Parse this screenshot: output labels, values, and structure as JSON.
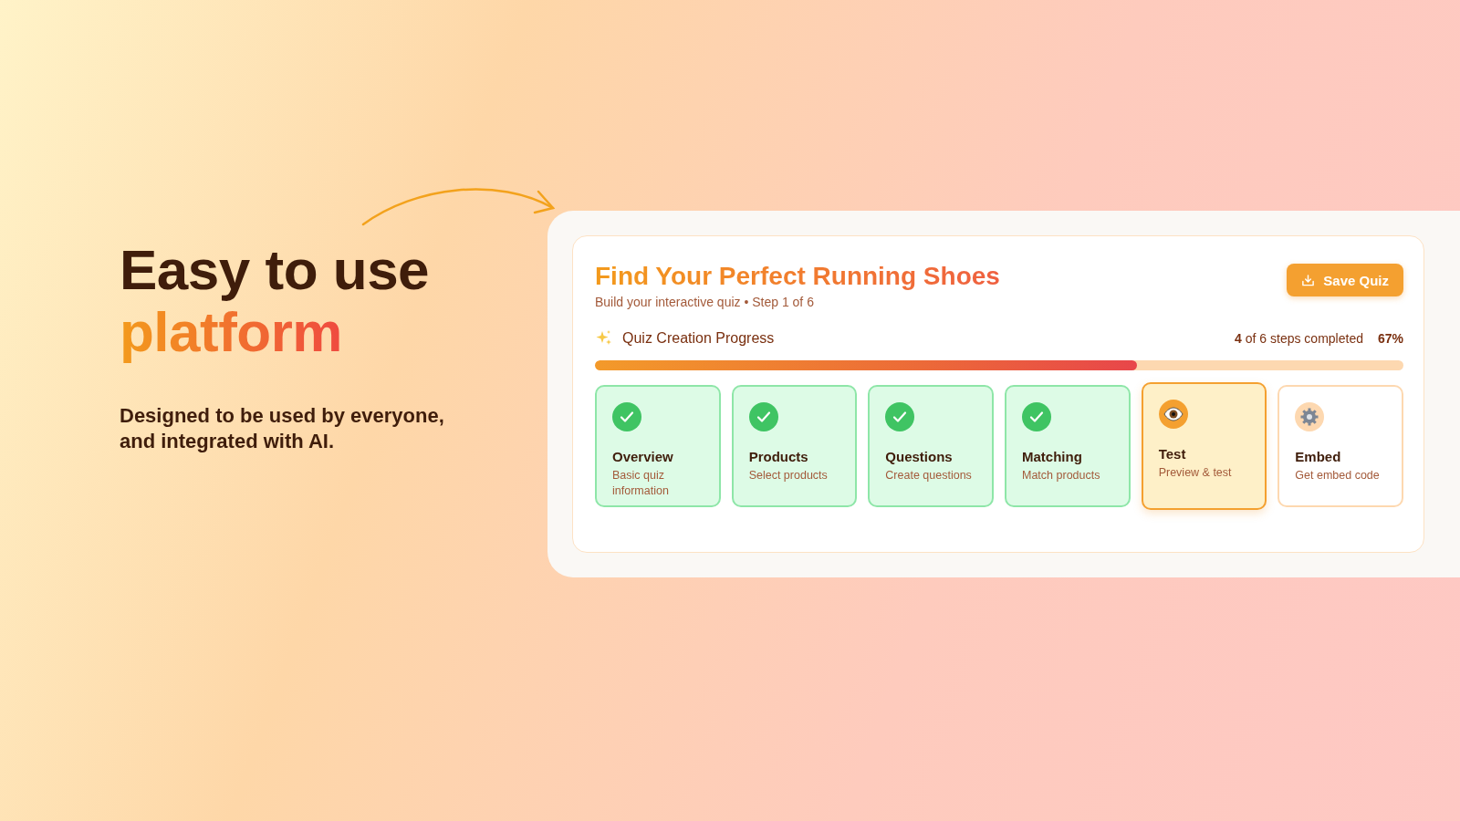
{
  "hero": {
    "title": "Easy to use",
    "title_accent": "platform",
    "subtitle": "Designed to be used by everyone, and integrated with AI."
  },
  "quiz": {
    "title": "Find Your Perfect Running Shoes",
    "subtitle": "Build your interactive quiz • Step 1 of 6",
    "save_button": "Save Quiz",
    "progress": {
      "label": "Quiz Creation Progress",
      "summary": "**4** of 6 steps completed",
      "percent": "67%",
      "level": 0.67
    },
    "steps": [
      {
        "kind": "done",
        "title": "Overview",
        "description": "Basic quiz information"
      },
      {
        "kind": "done",
        "title": "Products",
        "description": "Select products"
      },
      {
        "kind": "done",
        "title": "Questions",
        "description": "Create questions"
      },
      {
        "kind": "done",
        "title": "Matching",
        "description": "Match products"
      },
      {
        "kind": "current",
        "title": "Test",
        "description": "Preview & test"
      },
      {
        "kind": "pending",
        "title": "Embed",
        "description": "Get embed code"
      }
    ]
  }
}
